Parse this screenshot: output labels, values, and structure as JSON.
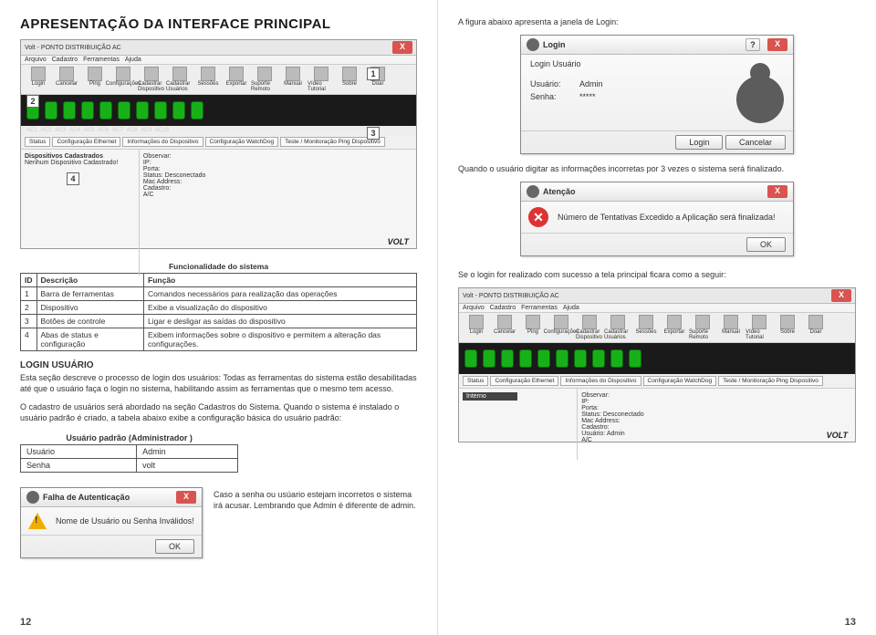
{
  "left": {
    "title": "APRESENTAÇÃO DA INTERFACE PRINCIPAL",
    "page_num": "12",
    "main_window": {
      "title": "Volt - PONTO DISTRIBUIÇÃO AC",
      "menubar": [
        "Arquivo",
        "Cadastro",
        "Ferramentas",
        "Ajuda"
      ],
      "toolbar": [
        "Login",
        "Cancelar",
        "Ping",
        "Configurações",
        "Cadastrar Dispositivo",
        "Cadastrar Usuários",
        "Sessões",
        "Exportar",
        "Suporte Remoto",
        "Manual",
        "Vídeo Tutorial",
        "Sobre",
        "Doar"
      ],
      "callouts": [
        "1",
        "2",
        "3",
        "4"
      ],
      "tabs": [
        "Status",
        "Configuração Ethernet",
        "Informações do Dispositivo",
        "Configuração WatchDog",
        "Teste / Monitoração Ping Dispositivo"
      ],
      "left_header": "Dispositivos Cadastrados",
      "left_body": "Nenhum Dispositivo Cadastrado!",
      "right_labels": {
        "obs": "Observar:",
        "ip": "IP:",
        "porta": "Porta:",
        "status": "Status: Desconectado",
        "mac": "Mac Address:",
        "cad": "Cadastro:",
        "ac": "A/C"
      },
      "brand": "VOLT"
    },
    "sys_table": {
      "caption": "Funcionalidade do sistema",
      "head": [
        "ID",
        "Descrição",
        "Função"
      ],
      "rows": [
        [
          "1",
          "Barra de ferramentas",
          "Comandos necessários para realização das operações"
        ],
        [
          "2",
          "Dispositivo",
          "Exibe a visualização do dispositivo"
        ],
        [
          "3",
          "Botões de controle",
          "Ligar e desligar as saídas do dispositivo"
        ],
        [
          "4",
          "Abas de status e configuração",
          "Exibem informações sobre o dispositivo e permitem a alteração das configurações."
        ]
      ]
    },
    "login_section": {
      "heading": "LOGIN USUÁRIO",
      "para1": "Esta seção descreve o processo de login dos usuários: Todas as ferramentas do sistema estão desabilitadas até que o usuário faça o login no sistema, habilitando assim as ferramentas que o mesmo tem acesso.",
      "para2": "O cadastro de usuários será abordado na seção Cadastros do Sistema. Quando o sistema é instalado o usuário padrão é criado, a tabela abaixo exibe a configuração básica do usuário padrão:"
    },
    "user_table": {
      "caption": "Usuário padrão (Administrador )",
      "rows": [
        [
          "Usuário",
          "Admin"
        ],
        [
          "Senha",
          "volt"
        ]
      ]
    },
    "auth_fail": {
      "title": "Falha de Autenticação",
      "msg": "Nome de Usuário ou Senha Inválidos!",
      "ok": "OK"
    },
    "auth_fail_caption": "Caso a senha ou usúario estejam incorretos o sistema irá acusar. Lembrando que Admin é diferente de admin."
  },
  "right": {
    "intro": "A figura abaixo apresenta a janela de Login:",
    "login_dialog": {
      "title": "Login",
      "sub": "Login Usuário",
      "user_label": "Usuário:",
      "user_value": "Admin",
      "pass_label": "Senha:",
      "pass_value": "*****",
      "login_btn": "Login",
      "cancel_btn": "Cancelar"
    },
    "wrong_note": "Quando o usuário digitar as informações incorretas por 3 vezes o sistema será finalizado.",
    "alert": {
      "title": "Atenção",
      "msg": "Número de Tentativas Excedido a Aplicação será finalizada!",
      "ok": "OK"
    },
    "success_note": "Se o login for realizado com sucesso a tela principal ficara como a seguir:",
    "loggedin": {
      "title": "Volt - PONTO DISTRIBUIÇÃO AC",
      "menubar": [
        "Arquivo",
        "Cadastro",
        "Ferramentas",
        "Ajuda"
      ],
      "toolbar": [
        "Login",
        "Cancelar",
        "Ping",
        "Configurações",
        "Cadastrar Dispositivo",
        "Cadastrar Usuários",
        "Sessões",
        "Exportar",
        "Suporte Remoto",
        "Manual",
        "Vídeo Tutorial",
        "Sobre",
        "Doar"
      ],
      "tabs": [
        "Status",
        "Configuração Ethernet",
        "Informações do Dispositivo",
        "Configuração WatchDog",
        "Teste / Monitoração Ping Dispositivo"
      ],
      "left_item": "Interno",
      "right_labels": {
        "obs": "Observar:",
        "ip": "IP:",
        "porta": "Porta:",
        "status": "Status: Desconectado",
        "mac": "Mac Address:",
        "cad": "Cadastro:",
        "user": "Usuário:",
        "user_val": "Admin",
        "ac": "A/C"
      },
      "brand": "VOLT"
    },
    "page_num": "13"
  }
}
